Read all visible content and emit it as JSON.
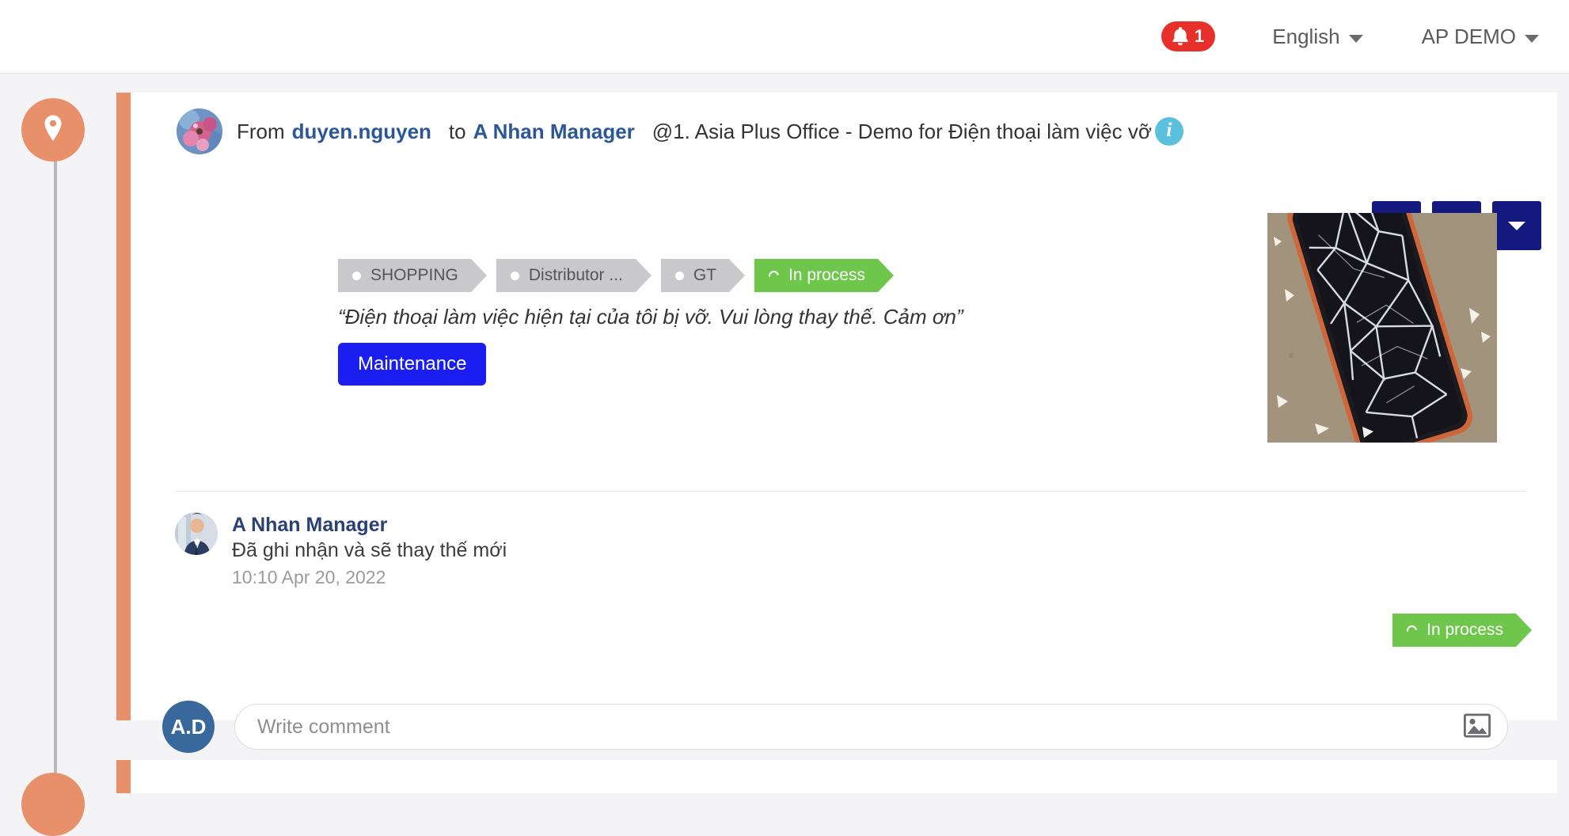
{
  "topbar": {
    "notification": {
      "icon": "bell-icon",
      "count": "1",
      "color": "#e8302a"
    },
    "language": {
      "label": "English",
      "icon": "chevron-down-icon"
    },
    "account": {
      "label": "AP DEMO",
      "icon": "chevron-down-icon"
    }
  },
  "timeline": {
    "pin_icon": "map-pin-icon",
    "pin_color": "#e8906a",
    "line_color": "#b7b7b7"
  },
  "post": {
    "author_avatar": "flower-avatar",
    "from_label": "From",
    "from_user": "duyen.nguyen",
    "to_label": "to",
    "to_user": "A Nhan Manager",
    "location": "@1. Asia Plus Office - Demo for Điện thoại làm việc vỡ",
    "info_icon": "info-icon",
    "info_letter": "i",
    "chips": [
      {
        "label": "SHOPPING",
        "type": "gray",
        "icon": "dot-icon"
      },
      {
        "label": "Distributor ...",
        "type": "gray",
        "icon": "dot-icon"
      },
      {
        "label": "GT",
        "type": "gray",
        "icon": "dot-icon"
      },
      {
        "label": "In process",
        "type": "green",
        "icon": "arc-icon"
      }
    ],
    "quote": "“Điện thoại làm việc hiện tại của tôi bị vỡ. Vui lòng thay thế. Cảm ơn”",
    "maintenance_label": "Maintenance",
    "maintenance_color": "#1a1ef0",
    "attachment_alt": "broken-phone-screen-photo",
    "actions": [
      {
        "name": "edit-button",
        "icon": "pencil-icon"
      },
      {
        "name": "delete-button",
        "icon": "trash-icon"
      },
      {
        "name": "more-button",
        "icon": "chevron-down-icon"
      }
    ],
    "action_color": "#13197e"
  },
  "comment": {
    "avatar": "manager-avatar",
    "author": "A Nhan Manager",
    "text": "Đã ghi nhận và sẽ thay thế mới",
    "time": "10:10 Apr 20, 2022",
    "status": {
      "label": "In process",
      "type": "green",
      "icon": "arc-icon",
      "color": "#6ec64b"
    }
  },
  "compose": {
    "avatar_initials": "A.D",
    "avatar_color": "#39699c",
    "placeholder": "Write comment",
    "value": "",
    "attach_icon": "image-icon"
  }
}
